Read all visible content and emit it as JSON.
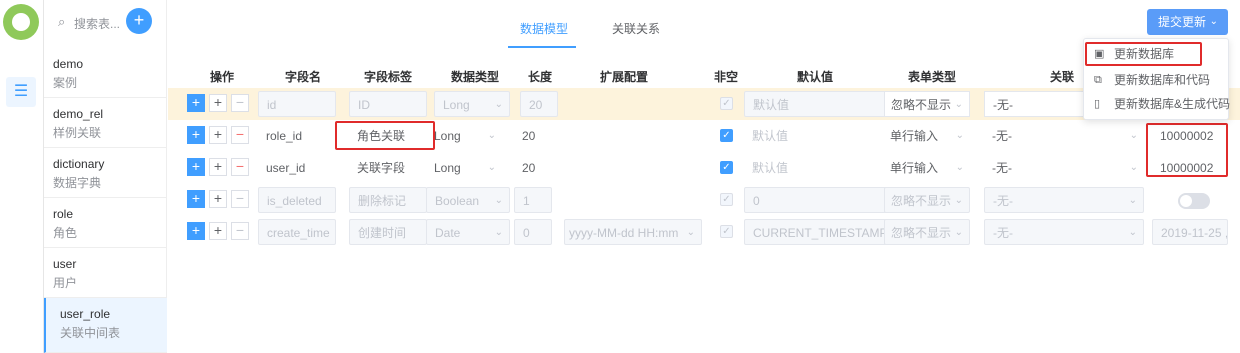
{
  "sidebar": {
    "search_placeholder": "搜索表...",
    "add_icon": "plus-icon",
    "items": [
      {
        "name": "demo",
        "label": "案例"
      },
      {
        "name": "demo_rel",
        "label": "样例关联"
      },
      {
        "name": "dictionary",
        "label": "数据字典"
      },
      {
        "name": "role",
        "label": "角色"
      },
      {
        "name": "user",
        "label": "用户"
      },
      {
        "name": "user_role",
        "label": "关联中间表"
      }
    ]
  },
  "tabs": [
    {
      "label": "数据模型",
      "active": true
    },
    {
      "label": "关联关系",
      "active": false
    }
  ],
  "toolbar": {
    "submit_label": "提交更新",
    "menu": [
      {
        "label": "更新数据库",
        "icon": "save-icon"
      },
      {
        "label": "更新数据库和代码",
        "icon": "copy-icon"
      },
      {
        "label": "更新数据库&生成代码",
        "icon": "file-icon"
      }
    ]
  },
  "table": {
    "headers": [
      "操作",
      "字段名",
      "字段标签",
      "数据类型",
      "长度",
      "扩展配置",
      "非空",
      "默认值",
      "表单类型",
      "关联"
    ],
    "rows": [
      {
        "field": "id",
        "label": "ID",
        "type": "Long",
        "length": "20",
        "ext": "",
        "not_null": true,
        "default": "默认值",
        "form": "忽略不显示",
        "rel": "-无-",
        "extra": "",
        "disabled": true
      },
      {
        "field": "role_id",
        "label": "角色关联",
        "type": "Long",
        "length": "20",
        "ext": "",
        "not_null": true,
        "default": "默认值",
        "form": "单行输入",
        "rel": "-无-",
        "extra": "10000002",
        "disabled": false
      },
      {
        "field": "user_id",
        "label": "关联字段",
        "type": "Long",
        "length": "20",
        "ext": "",
        "not_null": true,
        "default": "默认值",
        "form": "单行输入",
        "rel": "-无-",
        "extra": "10000002",
        "disabled": false
      },
      {
        "field": "is_deleted",
        "label": "删除标记",
        "type": "Boolean",
        "length": "1",
        "ext": "",
        "not_null": true,
        "default": "0",
        "form": "忽略不显示",
        "rel": "-无-",
        "extra": "",
        "disabled": true
      },
      {
        "field": "create_time",
        "label": "创建时间",
        "type": "Date",
        "length": "0",
        "ext": "yyyy-MM-dd HH:mm",
        "not_null": true,
        "default": "CURRENT_TIMESTAMP",
        "form": "忽略不显示",
        "rel": "-无-",
        "extra": "2019-11-25 ,",
        "disabled": true
      }
    ]
  },
  "colors": {
    "accent": "#409eff",
    "highlight": "#e02b2b",
    "row_highlight": "#fdf3dc"
  }
}
